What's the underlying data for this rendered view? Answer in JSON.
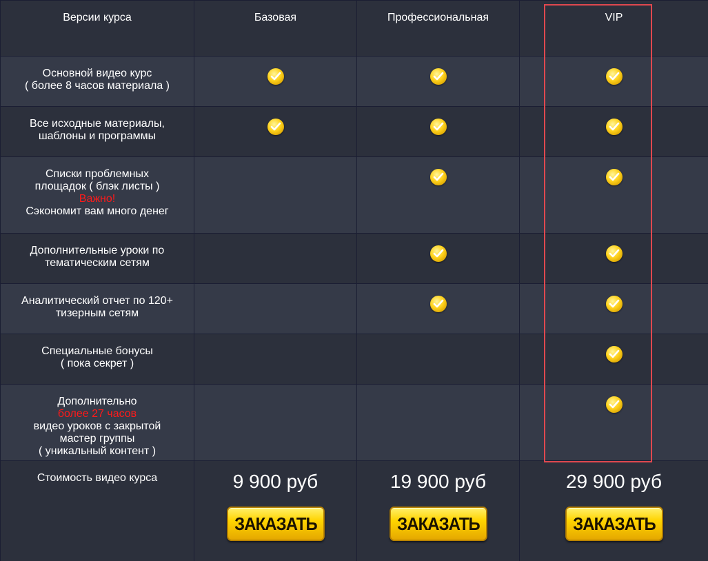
{
  "header": {
    "col_features": "Версии курса",
    "col_basic": "Базовая",
    "col_pro": "Профессиональная",
    "col_vip": "VIP"
  },
  "features": [
    {
      "lines": [
        "Основной видео курс",
        "( более 8 часов материала )"
      ],
      "basic": true,
      "pro": true,
      "vip": true
    },
    {
      "lines": [
        "Все исходные материалы,",
        "шаблоны и программы"
      ],
      "basic": true,
      "pro": true,
      "vip": true
    },
    {
      "lines": [
        "Списки проблемных",
        "площадок ( блэк листы )"
      ],
      "warning": "Важно!",
      "after": "Сэкономит вам много денег",
      "basic": false,
      "pro": true,
      "vip": true
    },
    {
      "lines": [
        "Дополнительные уроки по",
        "тематическим сетям"
      ],
      "basic": false,
      "pro": true,
      "vip": true
    },
    {
      "lines": [
        "Аналитический отчет по 120+",
        "тизерным сетям"
      ],
      "basic": false,
      "pro": true,
      "vip": true
    },
    {
      "lines": [
        "Специальные бонусы",
        "( пока секрет )"
      ],
      "basic": false,
      "pro": false,
      "vip": true
    },
    {
      "lines": [
        "Дополнительно"
      ],
      "warning": "более 27 часов",
      "after_lines": [
        "видео уроков с закрытой",
        "мастер группы",
        "( уникальный контент )"
      ],
      "basic": false,
      "pro": false,
      "vip": true
    }
  ],
  "pricing": {
    "label": "Стоимость видео курса",
    "basic_price": "9 900 руб",
    "pro_price": "19 900 руб",
    "vip_price": "29 900 руб",
    "order_label": "ЗАКАЗАТЬ"
  },
  "colors": {
    "background": "#2b2f3b",
    "check": "#ffd21c",
    "warning": "#ff1a1a",
    "vip_frame": "#e0484f"
  },
  "icons": {
    "check": "check-circle-icon"
  }
}
